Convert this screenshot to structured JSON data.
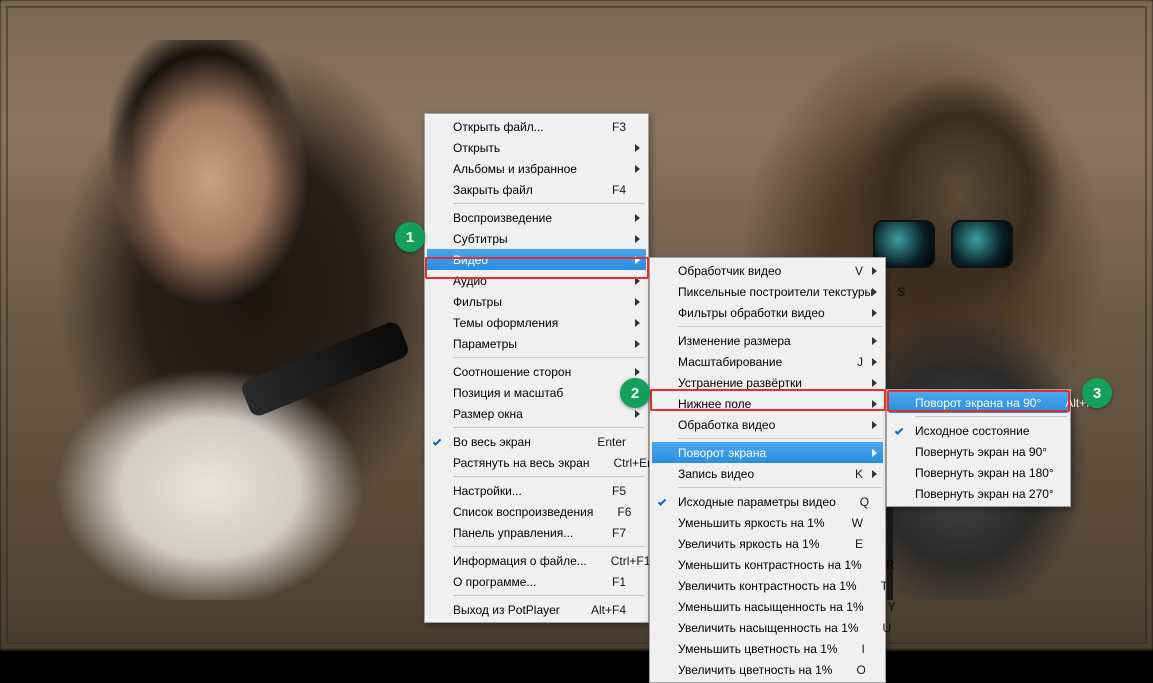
{
  "annotations": {
    "badge1": "1",
    "badge2": "2",
    "badge3": "3"
  },
  "menu1": {
    "items": [
      {
        "label": "Открыть файл...",
        "accel": "F3"
      },
      {
        "label": "Открыть",
        "sub": true
      },
      {
        "label": "Альбомы и избранное",
        "sub": true
      },
      {
        "label": "Закрыть файл",
        "accel": "F4"
      },
      {
        "sep": true
      },
      {
        "label": "Воспроизведение",
        "sub": true
      },
      {
        "label": "Субтитры",
        "sub": true
      },
      {
        "label": "Видео",
        "sub": true,
        "highlight": true
      },
      {
        "label": "Аудио",
        "sub": true
      },
      {
        "label": "Фильтры",
        "sub": true
      },
      {
        "label": "Темы оформления",
        "sub": true
      },
      {
        "label": "Параметры",
        "sub": true
      },
      {
        "sep": true
      },
      {
        "label": "Соотношение сторон",
        "sub": true
      },
      {
        "label": "Позиция и масштаб",
        "sub": true
      },
      {
        "label": "Размер окна",
        "sub": true
      },
      {
        "sep": true
      },
      {
        "label": "Во весь экран",
        "accel": "Enter",
        "check": true
      },
      {
        "label": "Растянуть на весь экран",
        "accel": "Ctrl+Enter"
      },
      {
        "sep": true
      },
      {
        "label": "Настройки...",
        "accel": "F5"
      },
      {
        "label": "Список воспроизведения",
        "accel": "F6"
      },
      {
        "label": "Панель управления...",
        "accel": "F7"
      },
      {
        "sep": true
      },
      {
        "label": "Информация о файле...",
        "accel": "Ctrl+F1"
      },
      {
        "label": "О программе...",
        "accel": "F1"
      },
      {
        "sep": true
      },
      {
        "label": "Выход из PotPlayer",
        "accel": "Alt+F4"
      }
    ]
  },
  "menu2": {
    "items": [
      {
        "label": "Обработчик видео",
        "accel": "V",
        "sub": true
      },
      {
        "label": "Пиксельные построители текстуры",
        "accel": "S",
        "sub": true
      },
      {
        "label": "Фильтры обработки видео",
        "sub": true
      },
      {
        "sep": true
      },
      {
        "label": "Изменение размера",
        "sub": true
      },
      {
        "label": "Масштабирование",
        "accel": "J",
        "sub": true
      },
      {
        "label": "Устранение развёртки",
        "sub": true
      },
      {
        "label": "Нижнее поле",
        "sub": true
      },
      {
        "label": "Обработка видео",
        "sub": true
      },
      {
        "sep": true
      },
      {
        "label": "Поворот экрана",
        "sub": true,
        "highlight": true
      },
      {
        "label": "Запись видео",
        "accel": "K",
        "sub": true
      },
      {
        "sep": true
      },
      {
        "label": "Исходные параметры видео",
        "accel": "Q",
        "check": true
      },
      {
        "label": "Уменьшить яркость на 1%",
        "accel": "W"
      },
      {
        "label": "Увеличить яркость на 1%",
        "accel": "E"
      },
      {
        "label": "Уменьшить контрастность на 1%",
        "accel": "R"
      },
      {
        "label": "Увеличить контрастность на 1%",
        "accel": "T"
      },
      {
        "label": "Уменьшить насыщенность на 1%",
        "accel": "Y"
      },
      {
        "label": "Увеличить насыщенность на 1%",
        "accel": "U"
      },
      {
        "label": "Уменьшить цветность на 1%",
        "accel": "I"
      },
      {
        "label": "Увеличить цветность на 1%",
        "accel": "O"
      }
    ]
  },
  "menu3": {
    "items": [
      {
        "label": "Поворот экрана на 90°",
        "accel": "Alt+K",
        "highlight": true
      },
      {
        "sep": true
      },
      {
        "label": "Исходное состояние",
        "check": true
      },
      {
        "label": "Повернуть экран на 90°"
      },
      {
        "label": "Повернуть экран на 180°"
      },
      {
        "label": "Повернуть экран на 270°"
      }
    ]
  }
}
